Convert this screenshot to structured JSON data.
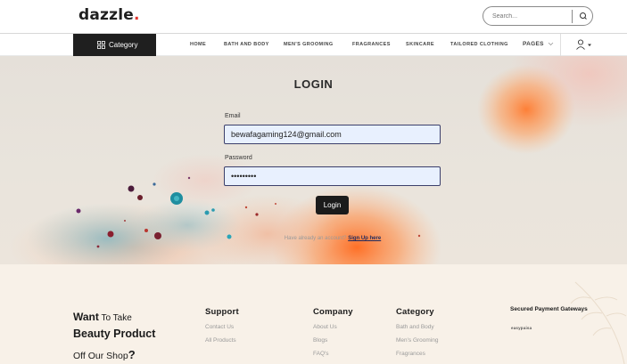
{
  "brand": {
    "name": "dazzle",
    "dot": "."
  },
  "search": {
    "placeholder": "Search..."
  },
  "nav": {
    "category_label": "Category",
    "items": [
      "HOME",
      "BATH AND BODY",
      "MEN'S GROOMING",
      "FRAGRANCES",
      "SKINCARE",
      "TAILORED CLOTHING"
    ],
    "pages_label": "PAGES"
  },
  "login": {
    "title": "LOGIN",
    "email_label": "Email",
    "email_value": "bewafagaming124@gmail.com",
    "password_label": "Password",
    "password_value": "•••••••••",
    "button_label": "Login",
    "signup_prompt": "Have already an account? ",
    "signup_link": "Sign Up here"
  },
  "footer": {
    "promo": {
      "want": "Want",
      "line1_rest": " To Take",
      "line2": "Beauty Product",
      "line3": "Off Our Shop",
      "qmark": "?"
    },
    "support": {
      "title": "Support",
      "links": [
        "Contact Us",
        "All Products"
      ]
    },
    "company": {
      "title": "Company",
      "links": [
        "About Us",
        "Blogs",
        "FAQ's"
      ]
    },
    "category": {
      "title": "Category",
      "links": [
        "Bath and Body",
        "Men's Grooming",
        "Fragrances"
      ]
    },
    "payment": {
      "title": "Secured Payment Gateways",
      "logo_text": "easypaisa"
    }
  },
  "colors": {
    "brand_dot": "#e4362f",
    "nav_dark": "#1f1f1f",
    "field_border": "#3b3f6b",
    "field_bg": "#e8f0fe",
    "footer_bg": "#f8f1e8",
    "link_navy": "#1f2a5e"
  },
  "icons": {
    "search": "search-icon",
    "category": "grid-icon",
    "pages_chevron": "chevron-down-icon",
    "user": "user-icon",
    "user_caret": "caret-down-icon"
  }
}
